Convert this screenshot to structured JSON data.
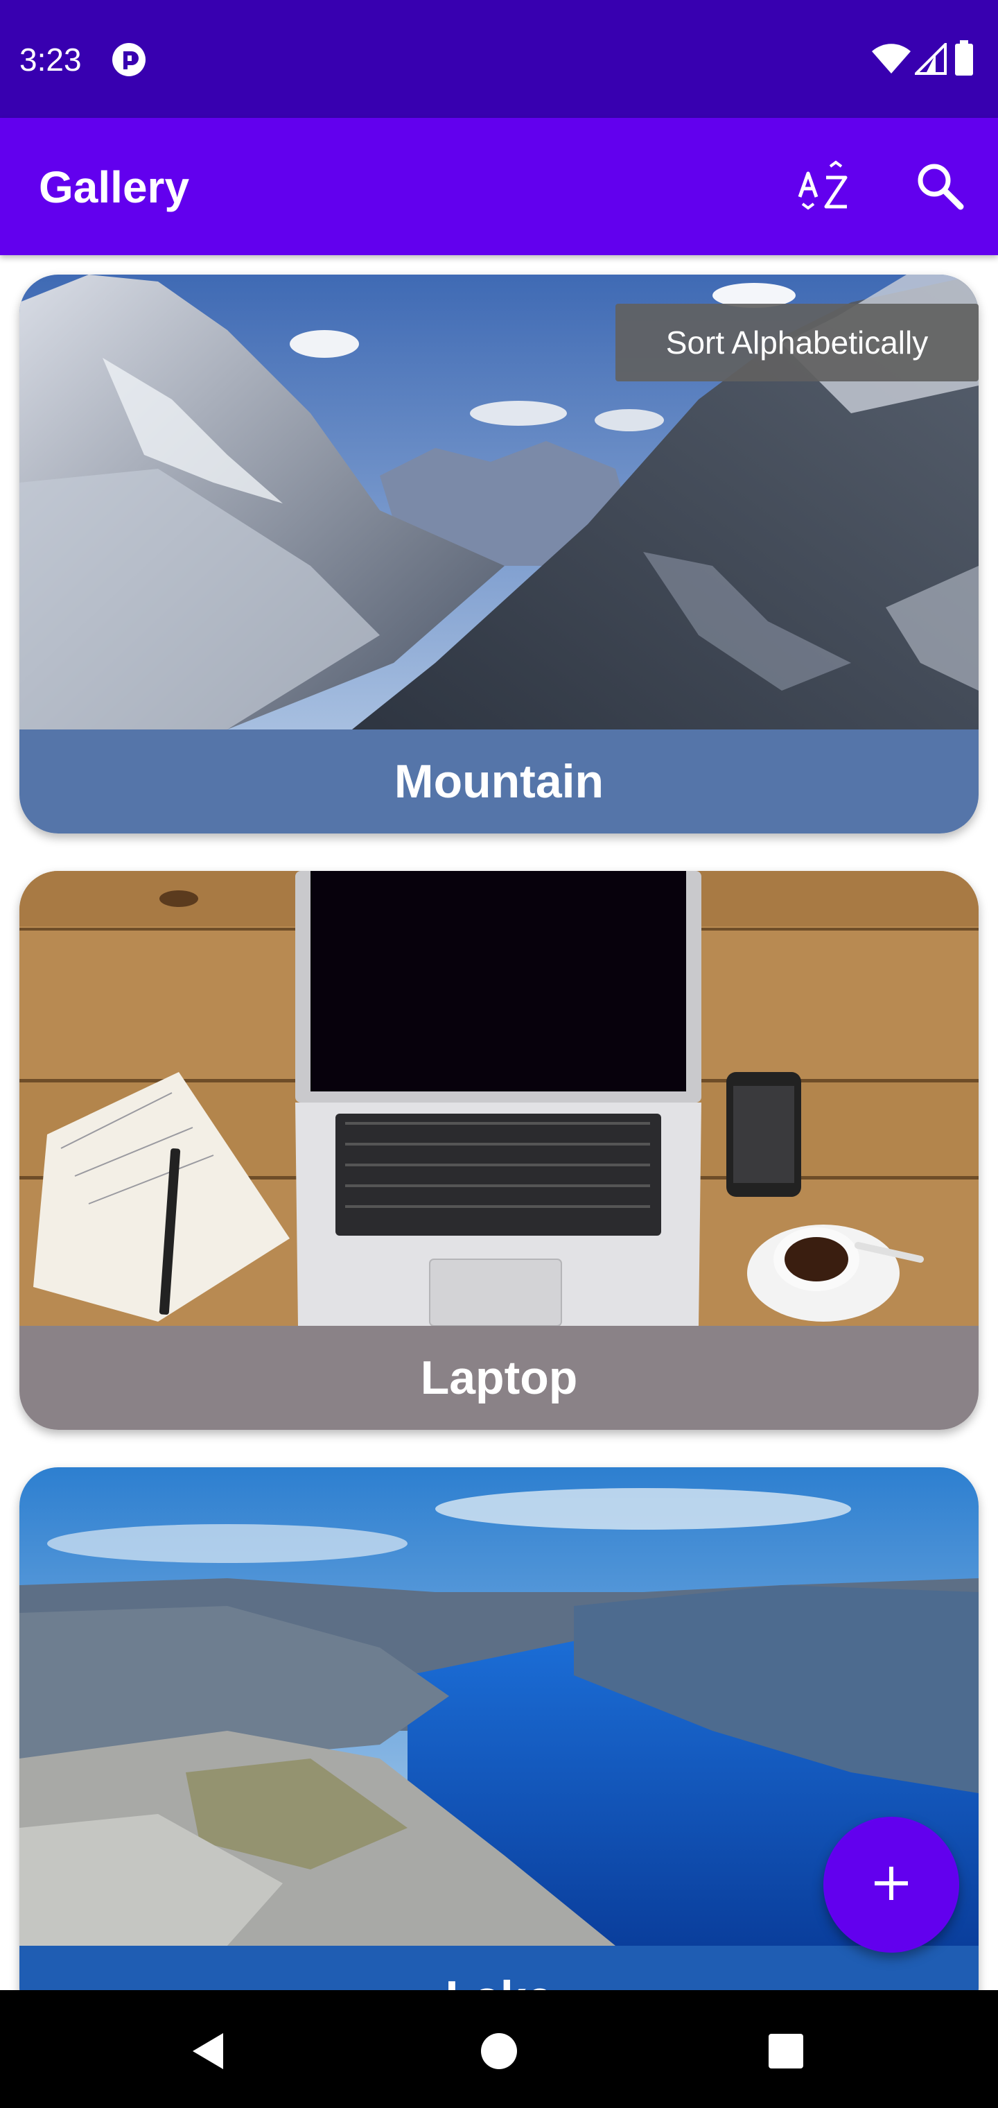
{
  "status_bar": {
    "time": "3:23",
    "app_icon": "pulse-app-icon",
    "icons": [
      "wifi-icon",
      "signal-icon",
      "battery-icon"
    ]
  },
  "app_bar": {
    "title": "Gallery",
    "actions": [
      {
        "name": "sort-alphabetically",
        "icon": "az-sort-icon"
      },
      {
        "name": "search",
        "icon": "search-icon"
      }
    ],
    "background": "#6200ee"
  },
  "tooltip": {
    "text": "Sort Alphabetically"
  },
  "gallery": {
    "items": [
      {
        "label": "Mountain",
        "caption_color": "#5575a9"
      },
      {
        "label": "Laptop",
        "caption_color": "#8a8287"
      },
      {
        "label": "Lake",
        "caption_color": "#1f5db3"
      }
    ]
  },
  "fab": {
    "icon": "plus-icon",
    "color": "#6200ee"
  },
  "nav_bar": {
    "buttons": [
      "back-icon",
      "home-icon",
      "recents-icon"
    ]
  }
}
